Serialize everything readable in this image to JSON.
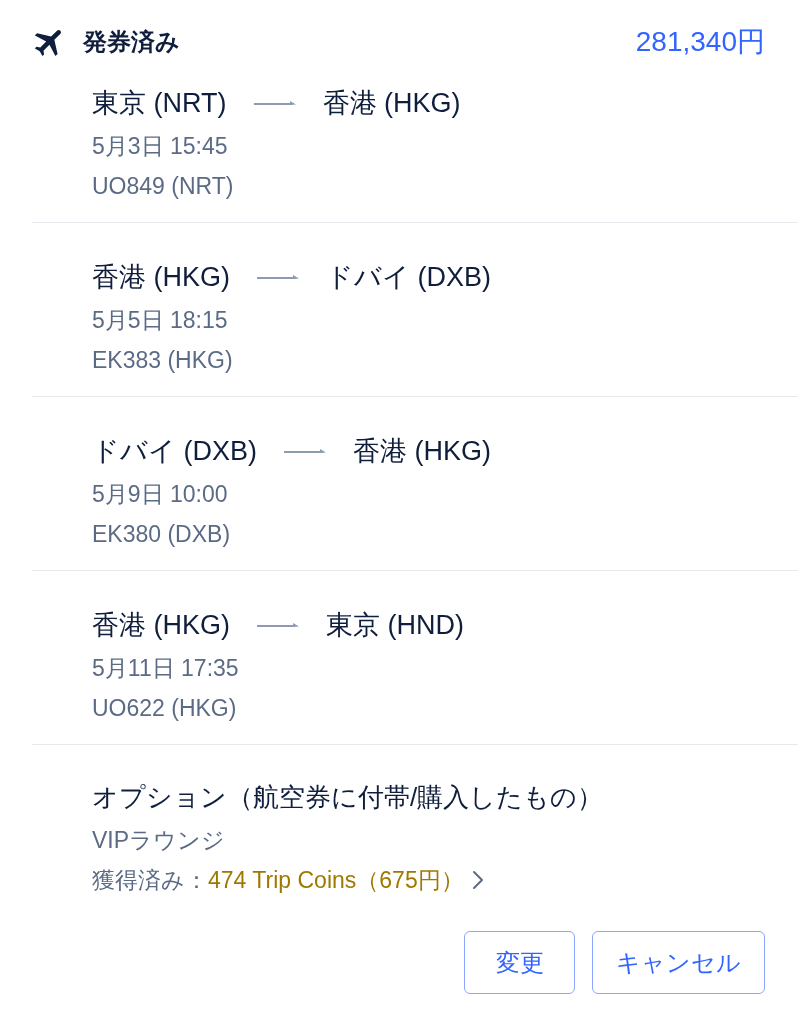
{
  "header": {
    "status": "発券済み",
    "price": "281,340円"
  },
  "segments": [
    {
      "from": "東京 (NRT)",
      "to": "香港 (HKG)",
      "datetime": "5月3日 15:45",
      "flight": "UO849 (NRT)"
    },
    {
      "from": "香港 (HKG)",
      "to": "ドバイ (DXB)",
      "datetime": "5月5日 18:15",
      "flight": "EK383 (HKG)"
    },
    {
      "from": "ドバイ (DXB)",
      "to": "香港 (HKG)",
      "datetime": "5月9日 10:00",
      "flight": "EK380 (DXB)"
    },
    {
      "from": "香港 (HKG)",
      "to": "東京 (HND)",
      "datetime": "5月11日 17:35",
      "flight": "UO622 (HKG)"
    }
  ],
  "options": {
    "title": "オプション（航空券に付帯/購入したもの）",
    "item": "VIPラウンジ",
    "coins_label": "獲得済み：",
    "coins_value": "474 Trip Coins（675円）"
  },
  "buttons": [
    "変更",
    "キャンセル"
  ]
}
